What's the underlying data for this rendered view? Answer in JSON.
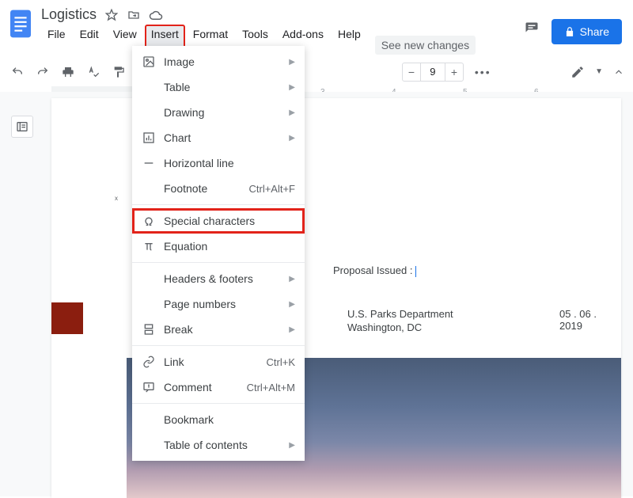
{
  "header": {
    "doc_title": "Logistics",
    "menus": {
      "file": "File",
      "edit": "Edit",
      "view": "View",
      "insert": "Insert",
      "format": "Format",
      "tools": "Tools",
      "addons": "Add-ons",
      "help": "Help"
    },
    "see_changes": "See new changes",
    "share_label": "Share"
  },
  "toolbar": {
    "font_size": "9"
  },
  "ruler": {
    "n3": "3",
    "n4": "4",
    "n5": "5",
    "n6": "6"
  },
  "insert_menu": {
    "image": "Image",
    "table": "Table",
    "drawing": "Drawing",
    "chart": "Chart",
    "horizontal_line": "Horizontal line",
    "footnote": "Footnote",
    "footnote_shortcut": "Ctrl+Alt+F",
    "special_characters": "Special characters",
    "equation": "Equation",
    "headers_footers": "Headers & footers",
    "page_numbers": "Page numbers",
    "break": "Break",
    "link": "Link",
    "link_shortcut": "Ctrl+K",
    "comment": "Comment",
    "comment_shortcut": "Ctrl+Alt+M",
    "bookmark": "Bookmark",
    "toc": "Table of contents"
  },
  "document": {
    "proposal_label": "Proposal Issued :",
    "dept": "U.S. Parks Department",
    "city": "Washington, DC",
    "date": "05 . 06 . 2019",
    "page_mark": "x"
  }
}
